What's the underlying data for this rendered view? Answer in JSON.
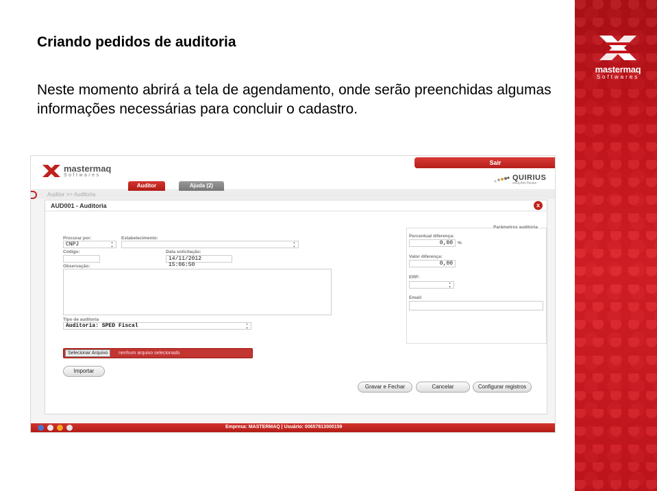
{
  "slide": {
    "title": "Criando pedidos de auditoria",
    "text": "Neste momento abrirá a tela de agendamento, onde serão preenchidas algumas informações necessárias para concluir o cadastro."
  },
  "brand": {
    "name": "mastermaq",
    "sub": "Softwares",
    "accent": "#c4151c"
  },
  "app": {
    "logo_name": "mastermaq",
    "logo_sub": "Softwares",
    "sair": "Sair",
    "partner": "QUIRIUS",
    "partner_sub": "soluções fiscais",
    "tabs": [
      "Auditor",
      "Ajuda (2)"
    ],
    "breadcrumb": "Auditor >> Auditoria",
    "panel_title": "AUD001 - Auditoria",
    "close": "x",
    "form": {
      "procurar_label": "Procurar por:",
      "procurar_value": "CNPJ",
      "estabelecimento_label": "Estabelecimento:",
      "estabelecimento_value": "",
      "codigo_label": "Código:",
      "codigo_value": "",
      "data_label": "Data solicitação:",
      "data_value": "14/11/2012 15:06:50",
      "observacao_label": "Observação:",
      "tipo_label": "Tipo de auditoria",
      "tipo_value": "Auditoria: SPED Fiscal",
      "file_button": "Selecionar Arquivo",
      "file_status": "nenhum arquivo selecionado",
      "importar": "Importar"
    },
    "params": {
      "title": "Parâmetros auditoria",
      "percentual_label": "Percentual diferença:",
      "percentual_value": "0,00",
      "percent_unit": "%",
      "valor_label": "Valor diferença:",
      "valor_value": "0,00",
      "erp_label": "ERP:",
      "erp_value": "",
      "email_label": "Email:",
      "email_value": ""
    },
    "actions": [
      "Gravar e Fechar",
      "Cancelar",
      "Configurar registros"
    ],
    "footer": "Empresa: MASTERMAQ | Usuário: 00657813000159"
  }
}
